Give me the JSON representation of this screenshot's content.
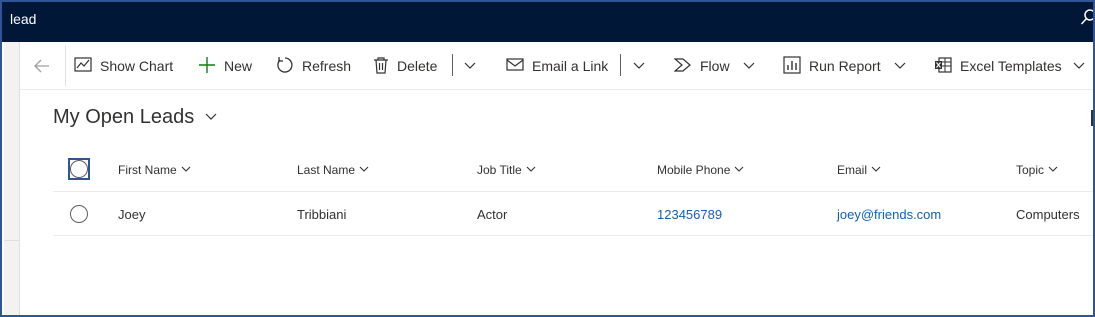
{
  "app": {
    "title": "lead"
  },
  "toolbar": {
    "show_chart": "Show Chart",
    "new": "New",
    "refresh": "Refresh",
    "delete": "Delete",
    "email_link": "Email a Link",
    "flow": "Flow",
    "run_report": "Run Report",
    "excel_templates": "Excel Templates"
  },
  "view": {
    "title": "My Open Leads"
  },
  "grid": {
    "columns": [
      "First Name",
      "Last Name",
      "Job Title",
      "Mobile Phone",
      "Email",
      "Topic"
    ],
    "rows": [
      {
        "first_name": "Joey",
        "last_name": "Tribbiani",
        "job_title": "Actor",
        "mobile_phone": "123456789",
        "email": "joey@friends.com",
        "topic": "Computers"
      }
    ]
  },
  "colors": {
    "topbar": "#001738",
    "link": "#1160b7",
    "frame": "#2f5597"
  },
  "icons": [
    "search-icon",
    "back-arrow-icon",
    "chart-icon",
    "plus-icon",
    "refresh-icon",
    "trash-icon",
    "chevron-down-icon",
    "email-link-icon",
    "flow-icon",
    "report-icon",
    "excel-icon"
  ]
}
